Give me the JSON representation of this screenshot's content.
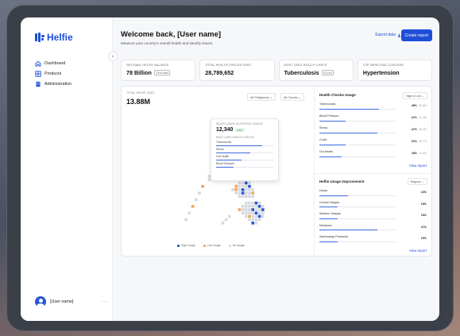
{
  "sidebar": {
    "logo": "Helfie",
    "collapse_icon": "‹",
    "items": [
      {
        "label": "Dashboard",
        "icon": "home-icon"
      },
      {
        "label": "Products",
        "icon": "grid-icon"
      },
      {
        "label": "Administration",
        "icon": "building-icon"
      }
    ],
    "user": {
      "name": "[User name]",
      "more": "···"
    }
  },
  "header": {
    "title": "Welcome back, [User name]",
    "subtitle": "Measure your country's overall health and identify issues.",
    "export_label": "Export data",
    "create_label": "Create report"
  },
  "kpis": [
    {
      "label": "National Helfie Balance",
      "value": "78 Billion",
      "badge": "23% used"
    },
    {
      "label": "Total Health Checks Used",
      "value": "28,789,652",
      "badge": ""
    },
    {
      "label": "Most Used Health Check",
      "value": "Tuberculosis",
      "badge": "32,164"
    },
    {
      "label": "Top Impacting Concern",
      "value": "Hypertension",
      "badge": ""
    }
  ],
  "map": {
    "label": "TOTAL HELFIE USED",
    "total": "13.88M",
    "filter_region": "All Philippines",
    "filter_checks": "All Checks",
    "tooltip": {
      "label": "HELFIE USAGE IN CENTRAL VISAYAS",
      "value": "12,340",
      "badge": "+5% ↑",
      "sub_label": "MOST USED HEALTH CHECKS",
      "items": [
        {
          "name": "Tuberculosis",
          "fill": 0.8
        },
        {
          "name": "Stress",
          "fill": 0.6
        },
        {
          "name": "Gut Health",
          "fill": 0.45
        },
        {
          "name": "Blood Pressure",
          "fill": 0.3
        }
      ]
    },
    "legend": [
      "High Usage",
      "Low Usage",
      "No Usage"
    ],
    "colors": {
      "high": "#2a56d6",
      "low": "#f2a65a",
      "none": "#d6d9df"
    }
  },
  "checks": {
    "title": "Health Checks Usage",
    "filter": "High to Low",
    "rows": [
      {
        "name": "Tuberculosis",
        "value": "48%",
        "delta": "32,164",
        "fill": 0.48
      },
      {
        "name": "Blood Pressure",
        "value": "21%",
        "delta": "21,145",
        "fill": 0.21
      },
      {
        "name": "Stress",
        "value": "47%",
        "delta": "20,190",
        "fill": 0.47
      },
      {
        "name": "Covid",
        "value": "21%",
        "delta": "18,774",
        "fill": 0.21
      },
      {
        "name": "Gut Health",
        "value": "18%",
        "delta": "11,420",
        "fill": 0.18
      }
    ],
    "view_label": "View report"
  },
  "improvement": {
    "title": "Helfie Usage Improvement",
    "filter": "Regions",
    "rows": [
      {
        "name": "Davao",
        "value": "23%",
        "fill": 0.23
      },
      {
        "name": "Central Visayas",
        "value": "15%",
        "fill": 0.15
      },
      {
        "name": "Western Visayas",
        "value": "15%",
        "fill": 0.15
      },
      {
        "name": "Mindanao",
        "value": "47%",
        "fill": 0.47
      },
      {
        "name": "Zamboanga Peninsula",
        "value": "15%",
        "fill": 0.15
      }
    ],
    "view_label": "View report"
  }
}
